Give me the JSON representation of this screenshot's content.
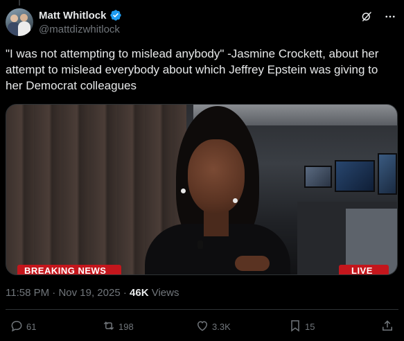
{
  "author": {
    "display_name": "Matt Whitlock",
    "handle": "@mattdizwhitlock",
    "verified": true
  },
  "tweet": {
    "text": "\"I was not attempting to mislead anybody\" -Jasmine Crockett, about her attempt to mislead everybody about which Jeffrey Epstein was giving to her Democrat colleagues",
    "time": "11:58 PM",
    "separator1": "·",
    "date": "Nov 19, 2025",
    "separator2": "·",
    "views_count": "46K",
    "views_label": "Views"
  },
  "media": {
    "banner_left": "BREAKING NEWS",
    "banner_right": "LIVE"
  },
  "actions": {
    "replies": "61",
    "reposts": "198",
    "likes": "3.3K",
    "bookmarks": "15"
  },
  "icons": {
    "verified": "verified-badge-icon",
    "grok": "grok-icon",
    "more": "more-icon",
    "reply": "reply-icon",
    "repost": "repost-icon",
    "like": "heart-icon",
    "bookmark": "bookmark-icon",
    "share": "share-icon"
  },
  "colors": {
    "background": "#000000",
    "text": "#e7e9ea",
    "muted": "#71767b",
    "verified": "#1d9bf0",
    "banner_red": "#c4161c",
    "border": "#2f3336"
  }
}
